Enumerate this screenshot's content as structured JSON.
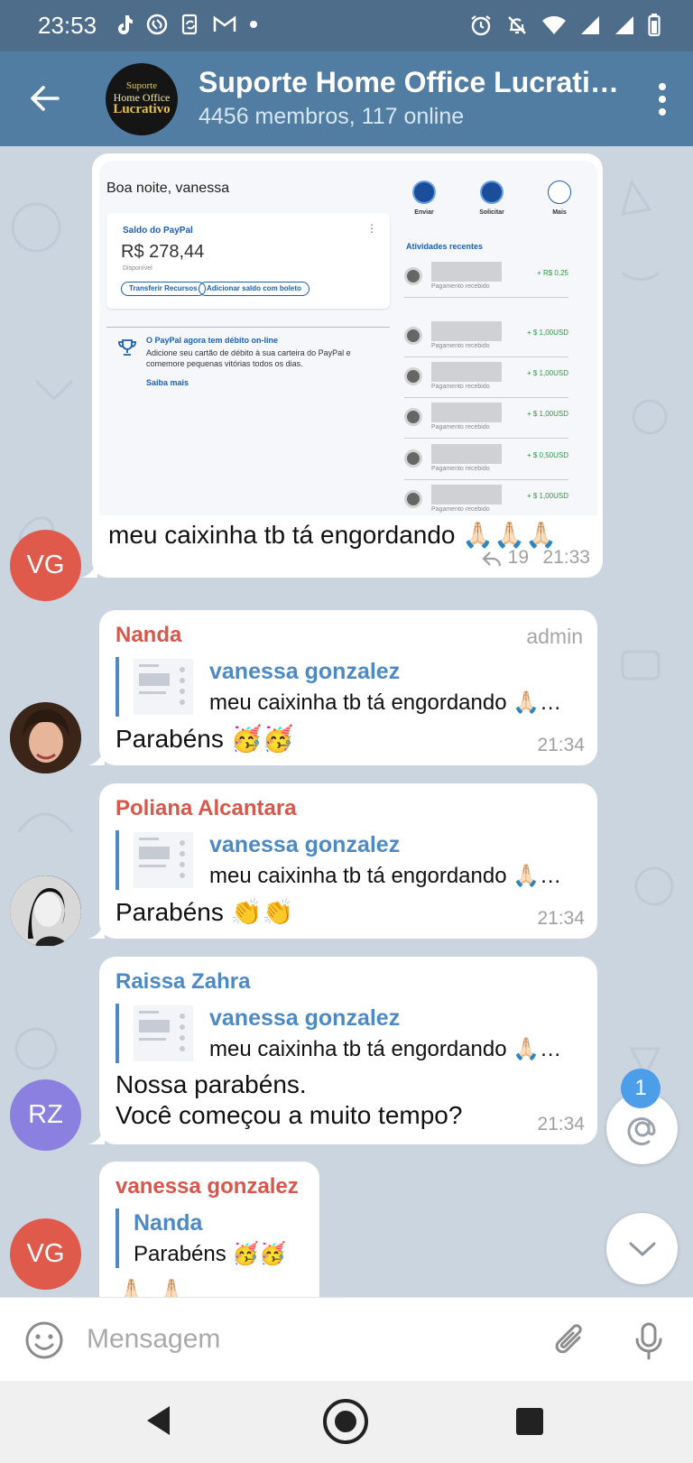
{
  "status_bar": {
    "time": "23:53"
  },
  "header": {
    "title": "Suporte Home Office Lucrati…",
    "subtitle": "4456 membros, 117 online",
    "avatar_logo": {
      "top": "Suporte",
      "mid": "Home Office",
      "bottom": "Lucrativo"
    }
  },
  "messages": {
    "m1": {
      "screenshot": {
        "greeting": "Boa noite, vanessa",
        "card_title": "Saldo do PayPal",
        "balance": "R$ 278,44",
        "available": "Disponível",
        "btn_transfer": "Transferir Recursos",
        "btn_add": "Adicionar saldo com boleto",
        "promo_title": "O PayPal agora tem débito on-line",
        "promo_text": "Adicione seu cartão de débito à sua carteira do PayPal e comemore pequenas vitórias todos os dias.",
        "promo_link": "Saiba mais",
        "action_send": "Enviar",
        "action_request": "Solicitar",
        "action_more": "Mais",
        "recent_title": "Atividades recentes",
        "rows": [
          {
            "sub": "Pagamento recebido",
            "amount": "+ R$ 0,25"
          },
          {
            "sub": "Pagamento recebido",
            "amount": "+ $ 1,00USD"
          },
          {
            "sub": "Pagamento recebido",
            "amount": "+ $ 1,00USD"
          },
          {
            "sub": "Pagamento recebido",
            "amount": "+ $ 1,00USD"
          },
          {
            "sub": "Pagamento recebido",
            "amount": "+ $ 0,50USD"
          },
          {
            "sub": "Pagamento recebido",
            "amount": "+ $ 1,00USD"
          }
        ]
      },
      "text": "meu caixinha tb tá engordando 🙏🏻🙏🏻🙏🏻",
      "reply_count": "19",
      "time": "21:33",
      "avatar": "VG"
    },
    "m2": {
      "sender": "Nanda",
      "role": "admin",
      "reply_name": "vanessa gonzalez",
      "reply_text": "meu caixinha tb tá engordando 🙏🏻…",
      "text": "Parabéns 🥳🥳",
      "time": "21:34"
    },
    "m3": {
      "sender": "Poliana Alcantara",
      "reply_name": "vanessa gonzalez",
      "reply_text": "meu caixinha tb tá engordando 🙏🏻…",
      "text": "Parabéns 👏👏",
      "time": "21:34"
    },
    "m4": {
      "sender": "Raissa Zahra",
      "reply_name": "vanessa gonzalez",
      "reply_text": "meu caixinha tb tá engordando 🙏🏻…",
      "text_line1": "Nossa parabéns.",
      "text_line2": "Você começou a muito tempo?",
      "time": "21:34",
      "avatar": "RZ"
    },
    "m5": {
      "sender": "vanessa gonzalez",
      "reply_name": "Nanda",
      "reply_text": "Parabéns 🥳🥳",
      "text": "🙏🏻🙏🏻",
      "avatar": "VG"
    }
  },
  "mention_count": "1",
  "input": {
    "placeholder": "Mensagem",
    "value": ""
  },
  "icons": [
    "back-arrow-icon",
    "more-vert-icon",
    "reply-arrow-icon",
    "at-icon",
    "chevron-down-icon",
    "emoji-icon",
    "attach-icon",
    "mic-icon",
    "nav-back-icon",
    "nav-home-icon",
    "nav-recent-icon"
  ],
  "colors": {
    "header": "#517da2",
    "status_bar": "#4d6d8b",
    "chat_bg": "#cbd5df",
    "sender_red": "#d7574a",
    "link_blue": "#4d8ac5",
    "badge": "#4d9ee8"
  }
}
